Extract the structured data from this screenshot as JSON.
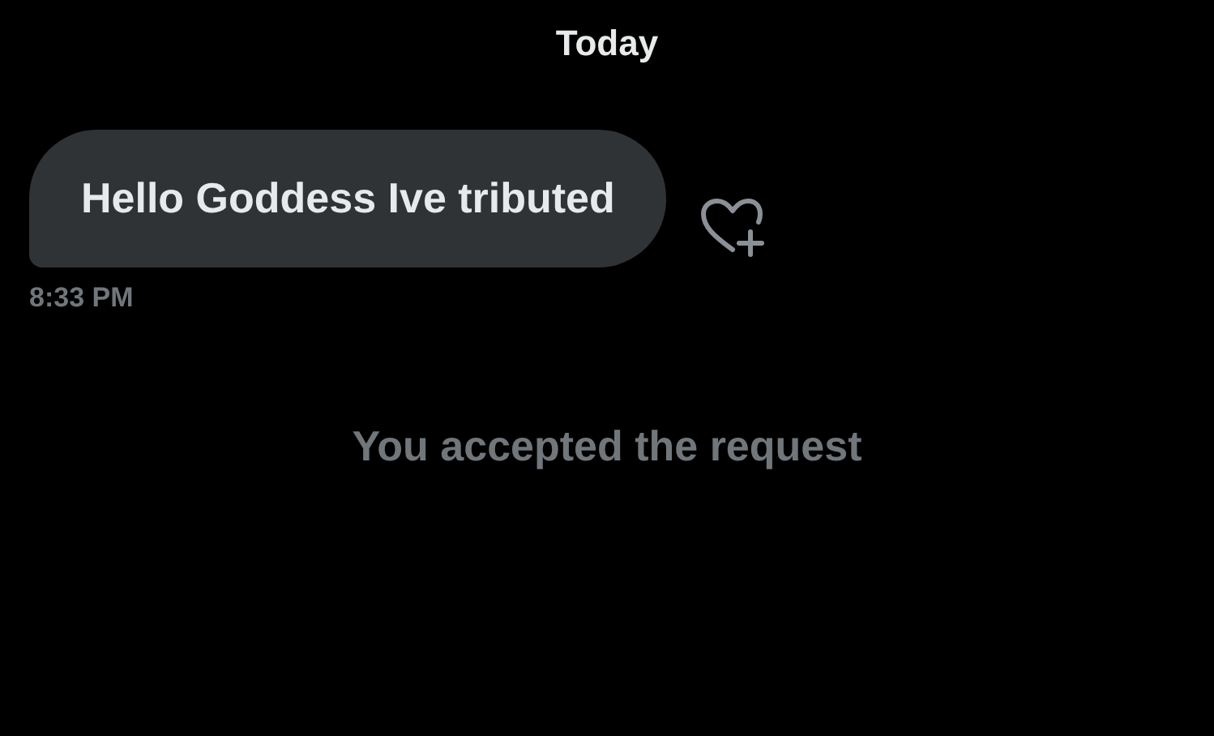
{
  "date_divider": "Today",
  "messages": [
    {
      "text": "Hello Goddess Ive tributed",
      "time": "8:33 PM"
    }
  ],
  "system_message": "You accepted the request"
}
